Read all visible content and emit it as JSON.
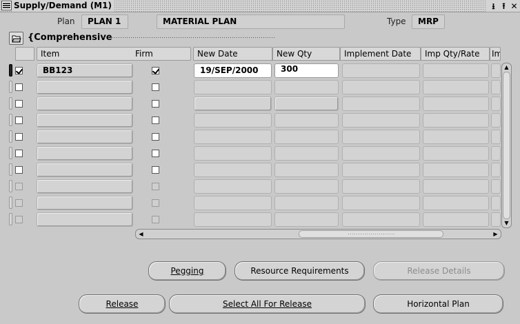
{
  "window": {
    "title": "Supply/Demand (M1)",
    "controls": [
      "⭳",
      "⭱",
      "✕"
    ]
  },
  "header": {
    "plan_label": "Plan",
    "plan_value": "PLAN 1",
    "plan_desc": "MATERIAL PLAN",
    "type_label": "Type",
    "type_value": "MRP"
  },
  "folder": {
    "name": "{Comprehensive"
  },
  "columns": [
    "Item",
    "Firm",
    "New Date",
    "New Qty",
    "Implement Date",
    "Imp Qty/Rate",
    "Im"
  ],
  "rows": [
    {
      "selected": true,
      "item": "BB123",
      "firm": true,
      "new_date": "19/SEP/2000",
      "new_qty": "300",
      "impl_date": "",
      "imp_qty": ""
    },
    {
      "selected": false,
      "item": "",
      "firm": false,
      "new_date": "",
      "new_qty": "",
      "impl_date": "",
      "imp_qty": ""
    },
    {
      "selected": false,
      "item": "",
      "firm": false,
      "new_date": "",
      "new_qty": "",
      "impl_date": "",
      "imp_qty": ""
    },
    {
      "selected": false,
      "item": "",
      "firm": false,
      "new_date": "",
      "new_qty": "",
      "impl_date": "",
      "imp_qty": ""
    },
    {
      "selected": false,
      "item": "",
      "firm": false,
      "new_date": "",
      "new_qty": "",
      "impl_date": "",
      "imp_qty": ""
    },
    {
      "selected": false,
      "item": "",
      "firm": false,
      "new_date": "",
      "new_qty": "",
      "impl_date": "",
      "imp_qty": ""
    },
    {
      "selected": false,
      "item": "",
      "firm": false,
      "new_date": "",
      "new_qty": "",
      "impl_date": "",
      "imp_qty": ""
    },
    {
      "selected": false,
      "item": "",
      "firm": false,
      "new_date": "",
      "new_qty": "",
      "impl_date": "",
      "imp_qty": ""
    },
    {
      "selected": false,
      "item": "",
      "firm": false,
      "new_date": "",
      "new_qty": "",
      "impl_date": "",
      "imp_qty": ""
    },
    {
      "selected": false,
      "item": "",
      "firm": false,
      "new_date": "",
      "new_qty": "",
      "impl_date": "",
      "imp_qty": ""
    }
  ],
  "buttons": {
    "pegging": "Pegging",
    "resource_requirements": "Resource Requirements",
    "release_details": "Release Details",
    "release": "Release",
    "select_all": "Select All For Release",
    "horizontal_plan": "Horizontal Plan"
  },
  "icons": {
    "folder": "folder-open-icon",
    "check": "checkmark-icon"
  }
}
